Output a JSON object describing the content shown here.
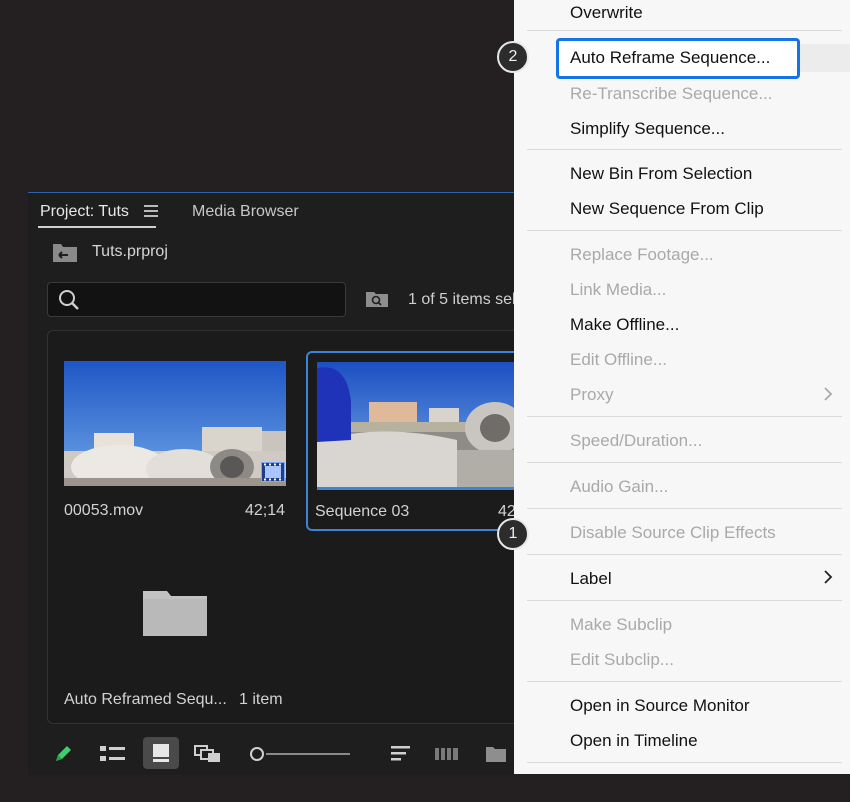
{
  "project_panel": {
    "tab_project": "Project: Tuts",
    "tab_media_browser": "Media Browser",
    "bin_name": "Tuts.prproj",
    "search": {
      "value": "",
      "placeholder": ""
    },
    "items_selected": "1 of 5 items sel",
    "clips": [
      {
        "name": "00053.mov",
        "duration": "42;14"
      },
      {
        "name": "Sequence 03",
        "duration": "42"
      }
    ],
    "bin_item": {
      "name": "Auto Reframed Sequ...",
      "count": "1 item"
    }
  },
  "context_menu": {
    "items": [
      {
        "label": "Overwrite",
        "enabled": true
      },
      {
        "label": "Auto Reframe Sequence...",
        "enabled": true,
        "highlighted": true
      },
      {
        "label": "Re-Transcribe Sequence...",
        "enabled": false
      },
      {
        "label": "Simplify Sequence...",
        "enabled": true
      },
      {
        "label": "New Bin From Selection",
        "enabled": true
      },
      {
        "label": "New Sequence From Clip",
        "enabled": true
      },
      {
        "label": "Replace Footage...",
        "enabled": false
      },
      {
        "label": "Link Media...",
        "enabled": false
      },
      {
        "label": "Make Offline...",
        "enabled": true
      },
      {
        "label": "Edit Offline...",
        "enabled": false
      },
      {
        "label": "Proxy",
        "enabled": false,
        "submenu": true
      },
      {
        "label": "Speed/Duration...",
        "enabled": false
      },
      {
        "label": "Audio Gain...",
        "enabled": false
      },
      {
        "label": "Disable Source Clip Effects",
        "enabled": false
      },
      {
        "label": "Label",
        "enabled": true,
        "submenu": true
      },
      {
        "label": "Make Subclip",
        "enabled": false
      },
      {
        "label": "Edit Subclip...",
        "enabled": false
      },
      {
        "label": "Open in Source Monitor",
        "enabled": true
      },
      {
        "label": "Open in Timeline",
        "enabled": true
      }
    ]
  },
  "badges": {
    "step1": "1",
    "step2": "2"
  },
  "colors": {
    "accent": "#1473e6",
    "selection": "#3b85d8",
    "panel_bg": "#1e1e1e",
    "menu_bg": "#f7f7f7"
  },
  "icons": [
    "menu-icon",
    "bin-up-icon",
    "search-icon",
    "find-icon",
    "film-icon",
    "folder-icon",
    "pencil-icon",
    "list-view-icon",
    "icon-view-icon",
    "freeform-view-icon",
    "sort-icon",
    "automate-icon",
    "new-bin-icon",
    "chevron-right-icon"
  ]
}
